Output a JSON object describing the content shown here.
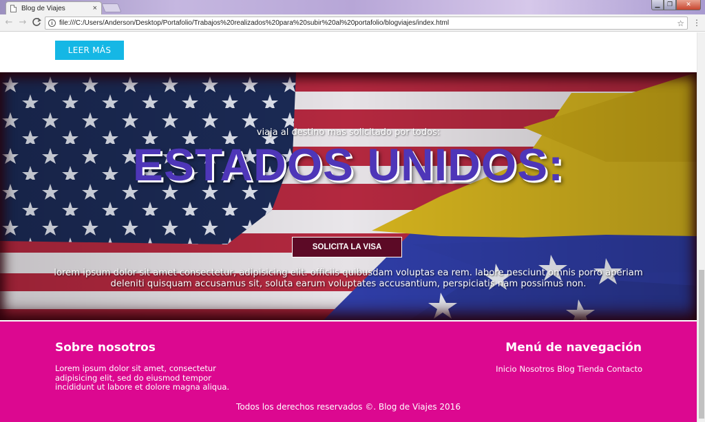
{
  "browser": {
    "tab_title": "Blog de Viajes",
    "tab_close": "×",
    "url": "file:///C:/Users/Anderson/Desktop/Portafolio/Trabajos%20realizados%20para%20subir%20al%20portafolio/blogviajes/index.html",
    "back_icon": "←",
    "forward_icon": "→",
    "reload_icon": "C",
    "star_icon": "☆",
    "menu_icon": "⋮",
    "info_icon": "i"
  },
  "page": {
    "read_more_label": "LEER MÁS",
    "hero": {
      "subtitle": "viaja al destino mas solicitado por todos:",
      "title": "ESTADOS UNIDOS:",
      "visa_button": "SOLICITA LA VISA",
      "text": "lorem ipsum dolor sit amet consectetur, adipisicing elit. officiis quibusdam voluptas ea rem. labore nesciunt omnis porro aperiam deleniti quisquam accusamus sit, soluta earum voluptates accusantium, perspiciatis nam possimus non."
    },
    "footer": {
      "about_title": "Sobre nosotros",
      "about_text": "Lorem ipsum dolor sit amet, consectetur adipisicing elit, sed do eiusmod tempor incididunt ut labore et dolore magna aliqua.",
      "nav_title": "Menú de navegación",
      "nav_links": [
        "Inicio",
        "Nosotros",
        "Blog",
        "Tienda",
        "Contacto"
      ],
      "copyright": "Todos los derechos reservados ©. Blog de Viajes 2016"
    }
  },
  "colors": {
    "read_more_bg": "#15b7e5",
    "hero_title": "#4e36b8",
    "visa_button_bg": "#5c0a26",
    "footer_bg": "#dc0890"
  }
}
